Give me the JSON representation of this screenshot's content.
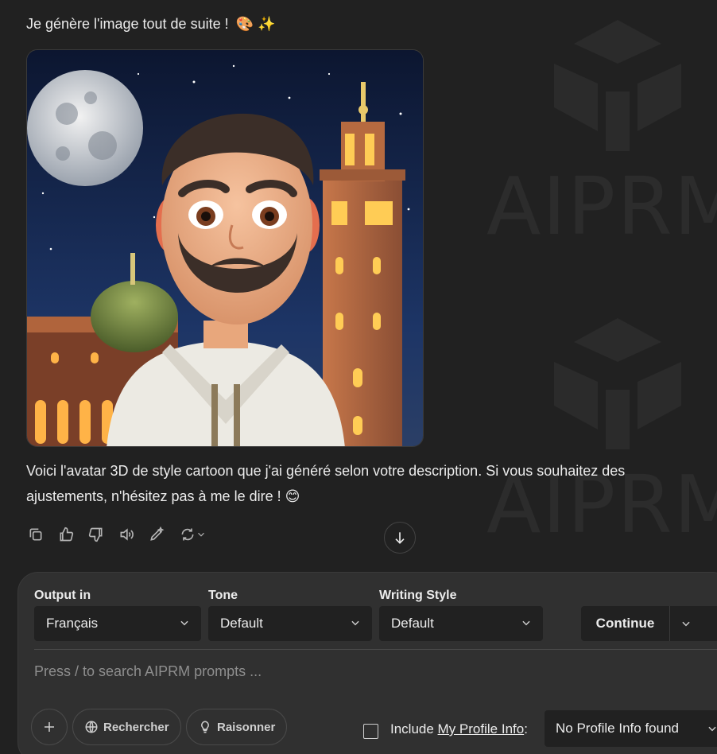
{
  "watermark": {
    "text_top": "AIPRM",
    "text_bottom": "AIPRM"
  },
  "message": {
    "intro": "Je génère l'image tout de suite !",
    "intro_emojis": "🎨 ✨",
    "body": "Voici l'avatar 3D de style cartoon que j'ai généré selon votre description. Si vous souhaitez des ajustements, n'hésitez pas à me le dire ! 😊"
  },
  "image": {
    "subject": "3D cartoon avatar of a bearded man in a white djellaba in front of the Koutoubia minaret at night with a full moon"
  },
  "actions": [
    "copy-icon",
    "thumbs-up-icon",
    "thumbs-down-icon",
    "speaker-icon",
    "edit-icon",
    "regenerate-icon"
  ],
  "composer": {
    "output_label": "Output in",
    "output_value": "Français",
    "tone_label": "Tone",
    "tone_value": "Default",
    "style_label": "Writing Style",
    "style_value": "Default",
    "continue_label": "Continue",
    "prompt_placeholder": "Press / to search AIPRM prompts ...",
    "search_label": "Rechercher",
    "reason_label": "Raisonner",
    "include_prefix": "Include ",
    "include_link": "My Profile Info",
    "include_suffix": ":",
    "profile_value": "No Profile Info found"
  },
  "colors": {
    "background": "#212121",
    "composer": "#303030",
    "select": "#212121"
  }
}
